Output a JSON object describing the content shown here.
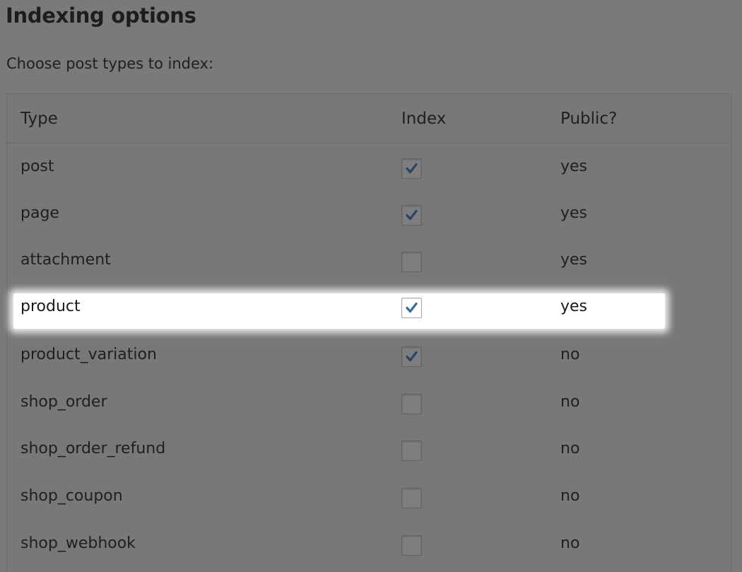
{
  "page": {
    "title": "Indexing options",
    "intro": "Choose post types to index:"
  },
  "table": {
    "headers": {
      "type": "Type",
      "index": "Index",
      "public": "Public?"
    },
    "rows": [
      {
        "type": "post",
        "indexed": true,
        "public": "yes",
        "highlighted": false
      },
      {
        "type": "page",
        "indexed": true,
        "public": "yes",
        "highlighted": false
      },
      {
        "type": "attachment",
        "indexed": false,
        "public": "yes",
        "highlighted": false
      },
      {
        "type": "product",
        "indexed": true,
        "public": "yes",
        "highlighted": true
      },
      {
        "type": "product_variation",
        "indexed": true,
        "public": "no",
        "highlighted": false
      },
      {
        "type": "shop_order",
        "indexed": false,
        "public": "no",
        "highlighted": false
      },
      {
        "type": "shop_order_refund",
        "indexed": false,
        "public": "no",
        "highlighted": false
      },
      {
        "type": "shop_coupon",
        "indexed": false,
        "public": "no",
        "highlighted": false
      },
      {
        "type": "shop_webhook",
        "indexed": false,
        "public": "no",
        "highlighted": false
      }
    ]
  },
  "colors": {
    "overlay_background": "#7a7a7a",
    "highlight": "#ffffff",
    "checkmark": "#2e6da4",
    "checkmark_dimmed": "#25476a"
  },
  "icons": {
    "checkmark": "checkmark-icon"
  }
}
